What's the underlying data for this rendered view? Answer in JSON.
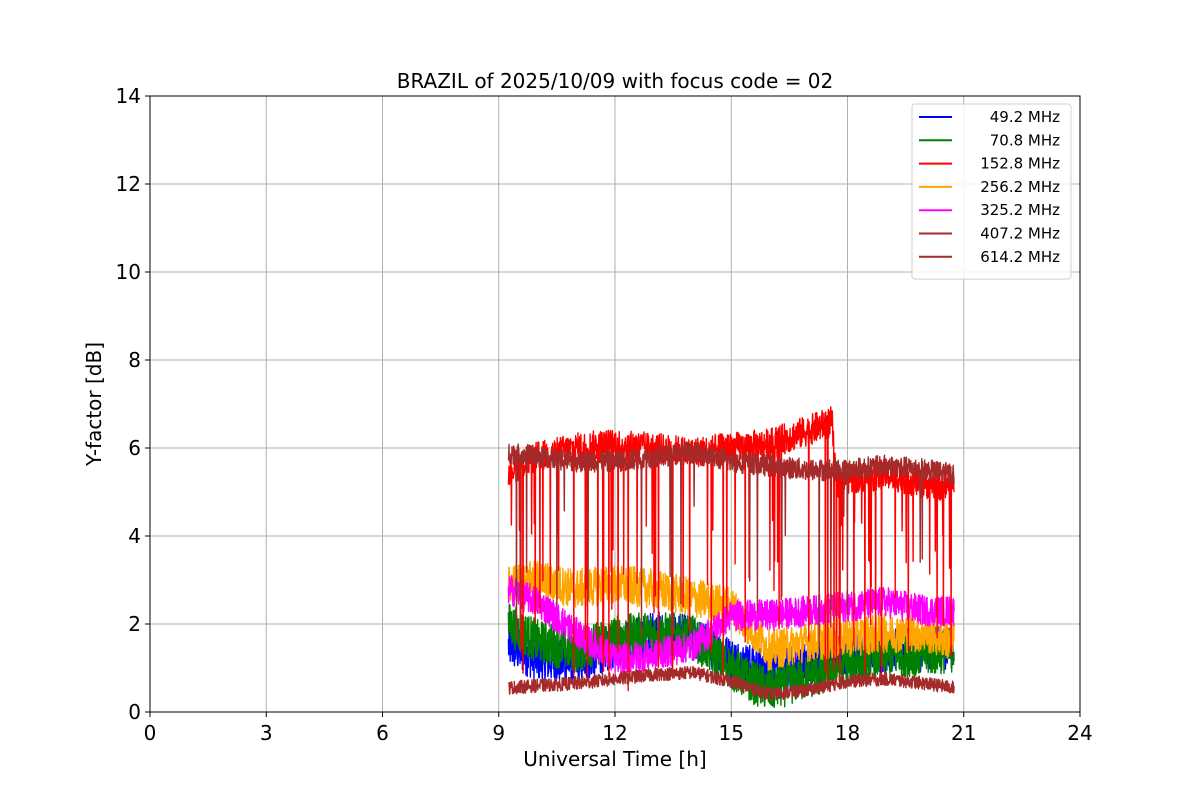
{
  "chart_data": {
    "type": "line",
    "title": "BRAZIL of 2025/10/09 with focus code = 02",
    "xlabel": "Universal Time [h]",
    "ylabel": "Y-factor [dB]",
    "xlim": [
      0,
      24
    ],
    "ylim": [
      0,
      14
    ],
    "xticks": [
      0,
      3,
      6,
      9,
      12,
      15,
      18,
      21,
      24
    ],
    "yticks": [
      0,
      2,
      4,
      6,
      8,
      10,
      12,
      14
    ],
    "grid": true,
    "legend_position": "top-right",
    "data_range_hours": [
      9.25,
      20.75
    ],
    "series": [
      {
        "name": " 49.2 MHz",
        "color": "#0000ff",
        "x": [
          9.25,
          10,
          11,
          12,
          13,
          14,
          15,
          16,
          17,
          18,
          19,
          20,
          20.75
        ],
        "y": [
          1.5,
          1.2,
          1.1,
          1.5,
          1.8,
          1.7,
          1.2,
          0.9,
          1.1,
          1.3,
          1.4,
          1.4,
          1.5
        ],
        "spread": 0.5
      },
      {
        "name": " 70.8 MHz",
        "color": "#008000",
        "x": [
          9.25,
          10,
          11,
          12,
          13,
          14,
          15,
          15.5,
          16,
          17,
          18,
          19,
          20,
          20.75
        ],
        "y": [
          2.0,
          1.6,
          1.4,
          1.7,
          1.8,
          1.7,
          1.0,
          0.7,
          0.5,
          0.8,
          1.1,
          1.3,
          1.3,
          1.4
        ],
        "spread": 0.5
      },
      {
        "name": "152.8 MHz",
        "color": "#ff0000",
        "x": [
          9.25,
          10,
          11,
          12,
          13,
          14,
          15,
          16,
          17,
          17.6,
          17.7,
          18,
          19,
          20,
          20.75
        ],
        "y": [
          5.5,
          5.8,
          6.0,
          6.1,
          6.0,
          5.9,
          6.0,
          6.1,
          6.4,
          6.6,
          5.2,
          5.3,
          5.4,
          5.2,
          5.1
        ],
        "spread": 0.35
      },
      {
        "name": "256.2 MHz",
        "color": "#ffa500",
        "x": [
          9.25,
          10,
          11,
          12,
          13,
          14,
          15,
          16,
          17,
          18,
          19,
          20,
          20.75
        ],
        "y": [
          2.9,
          3.0,
          2.8,
          2.9,
          2.8,
          2.6,
          2.4,
          1.4,
          1.6,
          1.7,
          1.8,
          1.8,
          1.6
        ],
        "spread": 0.45
      },
      {
        "name": "325.2 MHz",
        "color": "#ff00ff",
        "x": [
          9.25,
          10,
          11,
          12,
          13,
          14,
          15,
          16,
          17,
          18,
          19,
          20,
          20.75
        ],
        "y": [
          2.8,
          2.5,
          1.8,
          1.2,
          1.3,
          1.5,
          2.2,
          2.2,
          2.3,
          2.4,
          2.5,
          2.3,
          2.3
        ],
        "spread": 0.35
      },
      {
        "name": "407.2 MHz",
        "color": "#a52a2a",
        "x": [
          9.25,
          10,
          11,
          12,
          13,
          14,
          15,
          16,
          17,
          18,
          19,
          20,
          20.75
        ],
        "y": [
          5.9,
          5.8,
          5.7,
          5.7,
          5.8,
          5.9,
          5.7,
          5.6,
          5.5,
          5.5,
          5.6,
          5.5,
          5.4
        ],
        "spread": 0.25
      },
      {
        "name": "614.2 MHz",
        "color": "#a52a2a",
        "x": [
          9.25,
          10,
          11,
          12,
          13,
          14,
          15,
          16,
          17,
          18,
          19,
          20,
          20.75
        ],
        "y": [
          0.55,
          0.6,
          0.65,
          0.75,
          0.85,
          0.9,
          0.7,
          0.4,
          0.5,
          0.7,
          0.75,
          0.65,
          0.55
        ],
        "spread": 0.15
      }
    ]
  }
}
